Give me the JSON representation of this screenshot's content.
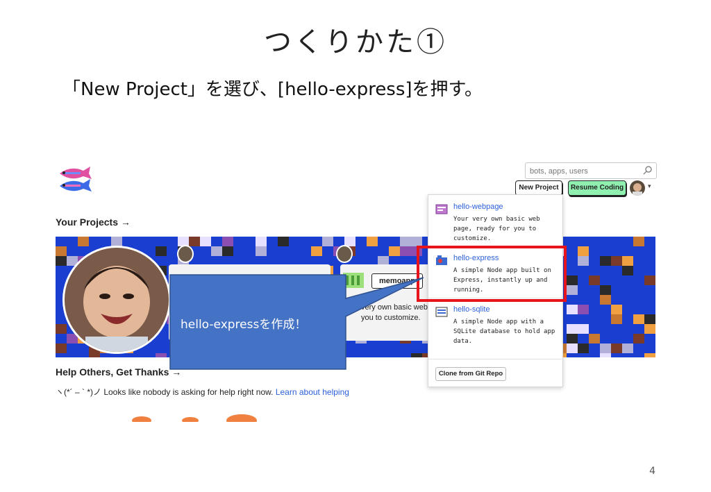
{
  "slide": {
    "title": "つくりかた①",
    "instruction": "「New Project」を選び、[hello-express]を押す。",
    "page_number": "4"
  },
  "header": {
    "search_placeholder": "bots, apps, users",
    "new_project_label": "New Project",
    "resume_coding_label": "Resume Coding",
    "avatar_caret": "▾"
  },
  "main": {
    "your_projects": "Your Projects →",
    "project_tag": "memoapp",
    "project_desc": "very own basic web you to customize.",
    "help_heading": "Help Others, Get Thanks →",
    "help_emoticon_text": "ヽ(*´ – ` *)ノ Looks like nobody is asking for help right now.",
    "help_link": "Learn about helping"
  },
  "dropdown": {
    "items": [
      {
        "title": "hello-webpage",
        "desc": "Your very own basic web page, ready for you to customize."
      },
      {
        "title": "hello-express",
        "desc": "A simple Node app built on Express, instantly up and running."
      },
      {
        "title": "hello-sqlite",
        "desc": "A simple Node app with a SQLite database to hold app data."
      }
    ],
    "clone_label": "Clone from Git Repo"
  },
  "callout": {
    "text": "hello-expressを作成！"
  },
  "colors": {
    "highlight": "#e8141c",
    "callout_fill": "#4472c4",
    "resume_green": "#8ff0b0",
    "link_blue": "#2b5fd9",
    "banner_blue": "#1a3fd0"
  }
}
